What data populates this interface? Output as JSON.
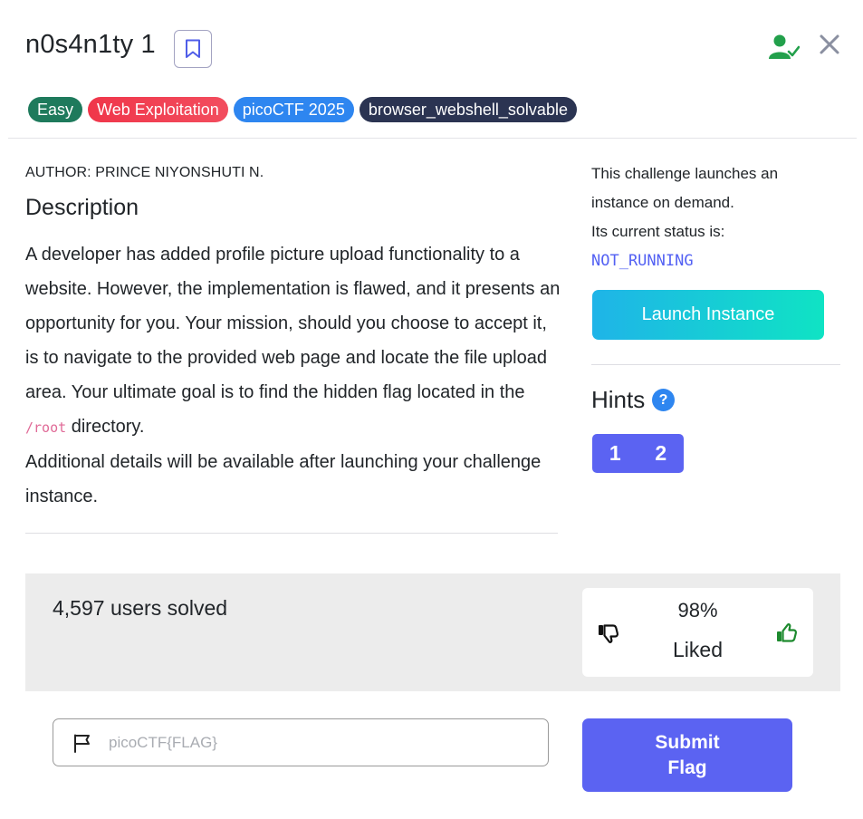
{
  "header": {
    "title": "n0s4n1ty 1"
  },
  "tags": [
    {
      "label": "Easy",
      "color": "#1e7a5c"
    },
    {
      "label": "Web Exploitation",
      "color": "#f0364a"
    },
    {
      "label": "picoCTF 2025",
      "color": "#2e86f0"
    },
    {
      "label": "browser_webshell_solvable",
      "color": "#2b3452"
    }
  ],
  "main": {
    "author": "AUTHOR: PRINCE NIYONSHUTI N.",
    "description_heading": "Description",
    "description_part1": "A developer has added profile picture upload functionality to a website. However, the implementation is flawed, and it presents an opportunity for you. Your mission, should you choose to accept it, is to navigate to the provided web page and locate the file upload area. Your ultimate goal is to find the hidden flag located in the ",
    "description_code": "/root",
    "description_part2": " directory.",
    "description_extra": "Additional details will be available after launching your challenge instance."
  },
  "instance": {
    "line1": "This challenge launches an instance on demand.",
    "line2": "Its current status is:",
    "status": "NOT_RUNNING",
    "launch_label": "Launch Instance"
  },
  "hints": {
    "heading": "Hints",
    "help_symbol": "?",
    "items": [
      "1",
      "2"
    ]
  },
  "stats": {
    "solved": "4,597 users solved",
    "liked_pct": "98%",
    "liked_label": "Liked"
  },
  "flag": {
    "placeholder": "picoCTF{FLAG}",
    "value": "",
    "submit_line1": "Submit",
    "submit_line2": "Flag"
  },
  "colors": {
    "accent": "#5b63f2",
    "success": "#22a04b",
    "status_code": "#5361f3"
  }
}
